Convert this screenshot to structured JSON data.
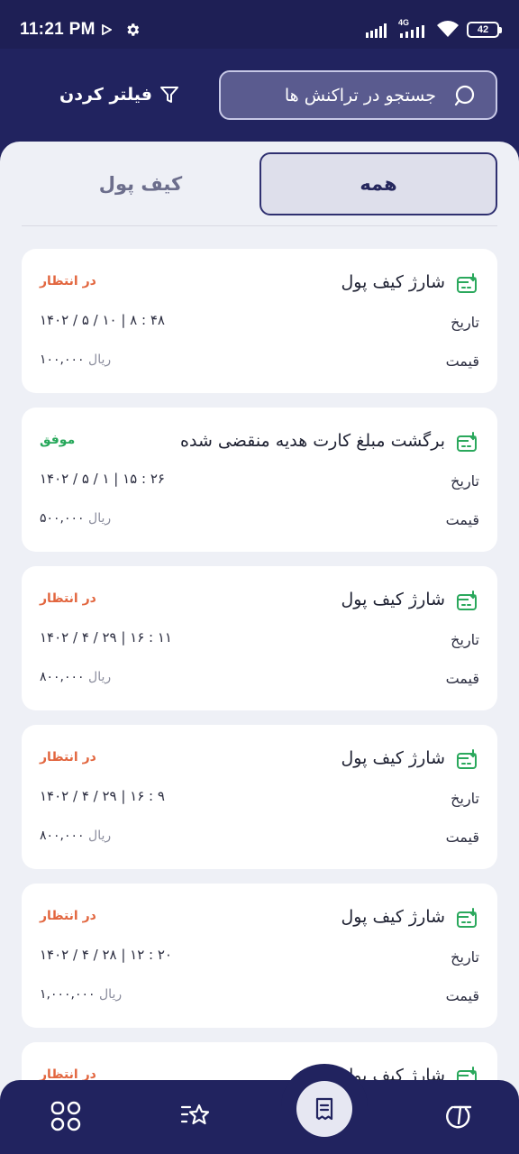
{
  "status_bar": {
    "time": "11:21 PM",
    "network": "4G",
    "battery": "42"
  },
  "header": {
    "search_placeholder": "جستجو در تراکنش ها",
    "filter_label": "فیلتر کردن"
  },
  "tabs": {
    "all_label": "همه",
    "wallet_label": "کیف پول",
    "active": "همه"
  },
  "labels": {
    "date": "تاریخ",
    "price": "قیمت",
    "unit": "ریال"
  },
  "transactions": [
    {
      "title": "شارژ کیف پول",
      "status": "در انتظار",
      "status_type": "pending",
      "date": "۱۴۰۲ / ۵ / ۱۰  |  ۸ : ۴۸",
      "amount": "۱۰۰,۰۰۰"
    },
    {
      "title": "برگشت مبلغ کارت هدیه منقضی شده",
      "status": "موفق",
      "status_type": "success",
      "date": "۱۴۰۲ / ۵ / ۱  |  ۱۵ : ۲۶",
      "amount": "۵۰۰,۰۰۰"
    },
    {
      "title": "شارژ کیف پول",
      "status": "در انتظار",
      "status_type": "pending",
      "date": "۱۴۰۲ / ۴ / ۲۹  |  ۱۶ : ۱۱",
      "amount": "۸۰۰,۰۰۰"
    },
    {
      "title": "شارژ کیف پول",
      "status": "در انتظار",
      "status_type": "pending",
      "date": "۱۴۰۲ / ۴ / ۲۹  |  ۱۶ : ۹",
      "amount": "۸۰۰,۰۰۰"
    },
    {
      "title": "شارژ کیف پول",
      "status": "در انتظار",
      "status_type": "pending",
      "date": "۱۴۰۲ / ۴ / ۲۸  |  ۱۲ : ۲۰",
      "amount": "۱,۰۰۰,۰۰۰"
    },
    {
      "title": "شارژ کیف پول",
      "status": "در انتظار",
      "status_type": "pending",
      "date": "",
      "amount": ""
    }
  ],
  "colors": {
    "primary": "#21235f",
    "pending": "#e2663f",
    "success": "#26a85a",
    "background": "#eef0f6"
  },
  "bottom_nav": {
    "items": [
      "dashboard-grid-icon",
      "favorites-list-icon",
      "receipt-icon",
      "loyalty-icon"
    ],
    "active": "receipt-icon"
  }
}
